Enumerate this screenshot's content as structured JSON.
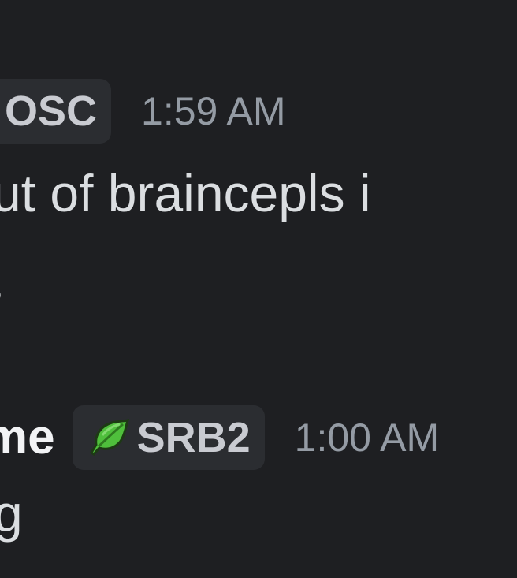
{
  "messages": [
    {
      "username": "",
      "tag": {
        "label": "OSC",
        "icon": ""
      },
      "timestamp": "1:59 AM",
      "lines": [
        "ut of braincepls i",
        "s"
      ]
    },
    {
      "username": "me",
      "tag": {
        "label": "SRB2",
        "icon": "leaf-icon"
      },
      "timestamp": "1:00 AM",
      "lines": [
        "g"
      ]
    }
  ],
  "colors": {
    "background": "#1e1f22",
    "tag_background": "#2b2d31",
    "timestamp": "#949ba4",
    "username": "#f2f3f5",
    "message_text": "#dbdee1",
    "leaf_green": "#4fbf3c"
  }
}
